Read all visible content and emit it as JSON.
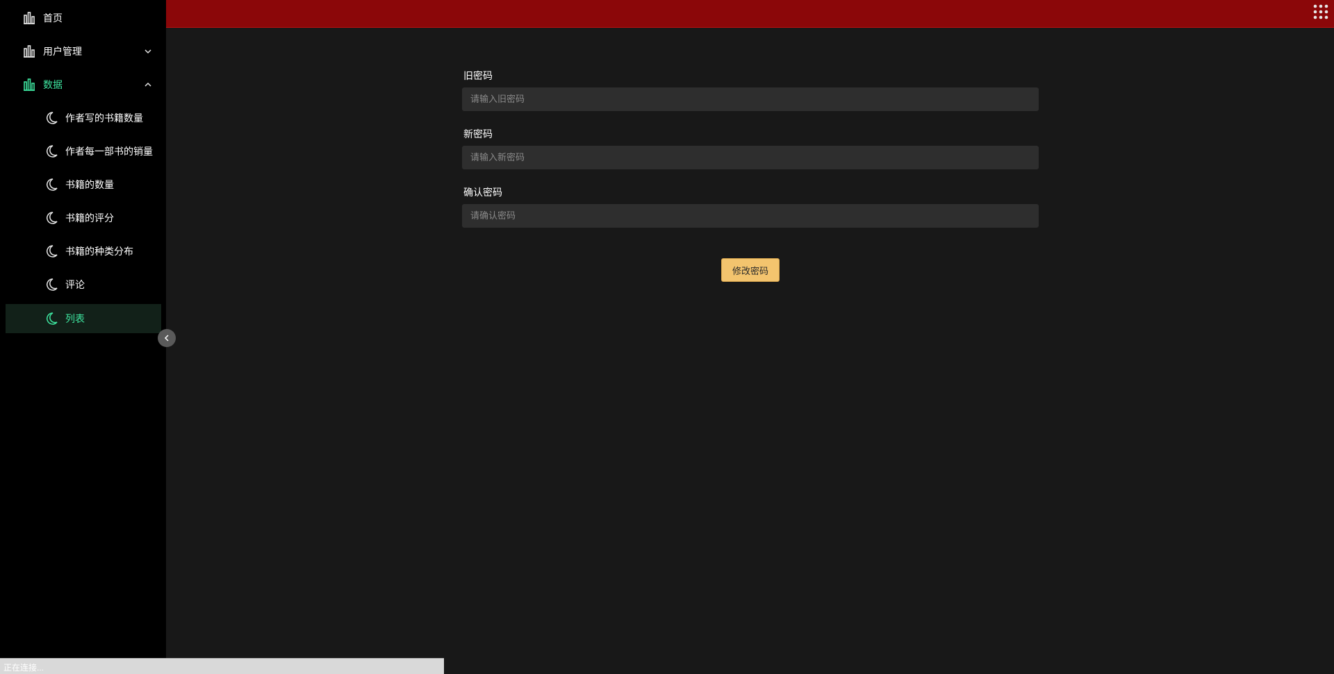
{
  "sidebar": {
    "home": "首页",
    "user_mgmt": "用户管理",
    "data": "数据",
    "sub_items": [
      "作者写的书籍数量",
      "作者每一部书的销量",
      "书籍的数量",
      "书籍的评分",
      "书籍的种类分布",
      "评论",
      "列表"
    ]
  },
  "form": {
    "old_label": "旧密码",
    "old_placeholder": "请输入旧密码",
    "new_label": "新密码",
    "new_placeholder": "请输入新密码",
    "confirm_label": "确认密码",
    "confirm_placeholder": "请确认密码",
    "submit": "修改密码"
  },
  "status": {
    "text": "正在连接..."
  },
  "colors": {
    "accent": "#3ee6a0",
    "header": "#8b0709",
    "button": "#f3c46e"
  },
  "icons": {
    "menu": "bar-chart-icon",
    "sub": "moon-icon",
    "apps": "grid-apps-icon"
  }
}
